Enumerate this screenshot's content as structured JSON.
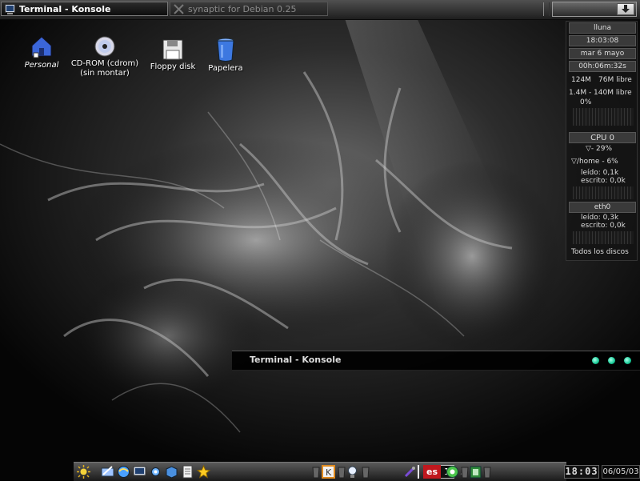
{
  "taskbar": {
    "tasks": [
      {
        "label": "Terminal - Konsole",
        "active": true
      },
      {
        "label": "synaptic for Debian 0.25",
        "active": false
      }
    ]
  },
  "desktop_icons": [
    {
      "label": "Personal",
      "icon": "home-folder-icon"
    },
    {
      "label": "CD-ROM (cdrom)\n(sin montar)",
      "icon": "cdrom-icon"
    },
    {
      "label": "Floppy disk",
      "icon": "floppy-icon"
    },
    {
      "label": "Papelera",
      "icon": "trash-icon"
    }
  ],
  "monitor": {
    "moon": "lluna",
    "time": "18:03:08",
    "date": "mar 6 mayo",
    "uptime": "00h:06m:32s",
    "mem": "124M",
    "mem_free": "76M libre",
    "swap": "1.4M - 140M libre",
    "swap_pct": "0%",
    "cpu_title": "CPU 0",
    "cpu_value": "- 29%",
    "disk_home": "/home - 6%",
    "disk_read": "leído: 0,1k",
    "disk_write": "escrito: 0,0k",
    "net_title": "eth0",
    "net_read": "leído: 0,3k",
    "net_write": "escrito: 0,0k",
    "all_disks": "Todos los discos"
  },
  "konsole_popup": {
    "title": "Terminal - Konsole"
  },
  "kicker": {
    "desktops": [
      "1",
      "2"
    ],
    "keyboard_layout": "es",
    "clock": "18:03",
    "date": "06/05/03"
  },
  "colors": {
    "accent": "#15c995",
    "panel": "#3a3a3a"
  }
}
